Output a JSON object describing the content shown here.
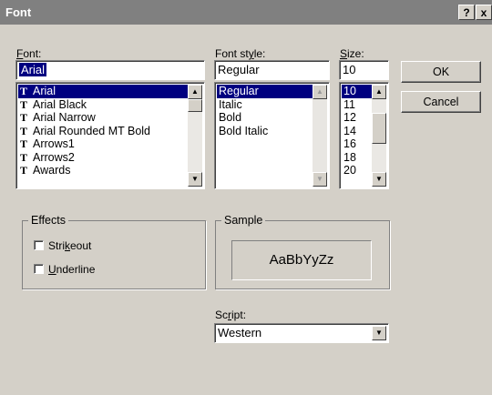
{
  "window": {
    "title": "Font",
    "help_label": "?",
    "close_label": "x"
  },
  "font": {
    "label_pre": "",
    "label_key": "F",
    "label_post": "ont:",
    "value": "Arial",
    "items": [
      {
        "icon": "T",
        "label": "Arial",
        "selected": true
      },
      {
        "icon": "T",
        "label": "Arial Black"
      },
      {
        "icon": "T",
        "label": "Arial Narrow"
      },
      {
        "icon": "T",
        "label": "Arial Rounded MT Bold"
      },
      {
        "icon": "T",
        "label": "Arrows1"
      },
      {
        "icon": "T",
        "label": "Arrows2"
      },
      {
        "icon": "T",
        "label": "Awards"
      }
    ]
  },
  "style": {
    "label_pre": "Font st",
    "label_key": "y",
    "label_post": "le:",
    "value": "Regular",
    "items": [
      {
        "label": "Regular",
        "selected": true
      },
      {
        "label": "Italic"
      },
      {
        "label": "Bold"
      },
      {
        "label": "Bold Italic"
      }
    ]
  },
  "size": {
    "label_pre": "",
    "label_key": "S",
    "label_post": "ize:",
    "value": "10",
    "items": [
      {
        "label": "10",
        "selected": true
      },
      {
        "label": "11"
      },
      {
        "label": "12"
      },
      {
        "label": "14"
      },
      {
        "label": "16"
      },
      {
        "label": "18"
      },
      {
        "label": "20"
      }
    ]
  },
  "buttons": {
    "ok": "OK",
    "cancel": "Cancel"
  },
  "effects": {
    "title": "Effects",
    "strikeout_pre": "Stri",
    "strikeout_key": "k",
    "strikeout_post": "eout",
    "underline_pre": "",
    "underline_key": "U",
    "underline_post": "nderline",
    "strikeout_checked": false,
    "underline_checked": false
  },
  "sample": {
    "title": "Sample",
    "text": "AaBbYyZz"
  },
  "script": {
    "label_pre": "Sc",
    "label_key": "r",
    "label_post": "ipt:",
    "value": "Western"
  },
  "icons": {
    "scroll_up": "up-arrow-icon",
    "scroll_down": "down-arrow-icon",
    "truetype": "truetype-icon"
  }
}
